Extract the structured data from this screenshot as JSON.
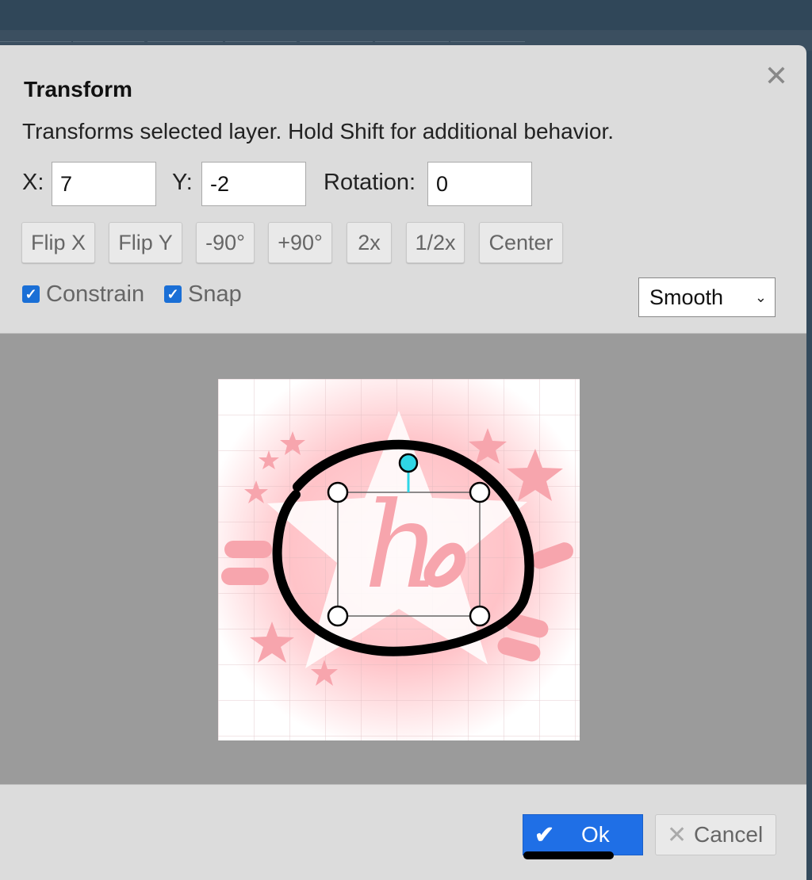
{
  "dialog": {
    "title": "Transform",
    "description": "Transforms selected layer. Hold Shift for additional behavior.",
    "close_icon": "close-icon"
  },
  "fields": {
    "x_label": "X:",
    "x_value": "7",
    "y_label": "Y:",
    "y_value": "-2",
    "rotation_label": "Rotation:",
    "rotation_value": "0"
  },
  "tools": {
    "flip_x": "Flip X",
    "flip_y": "Flip Y",
    "rotate_ccw": "-90°",
    "rotate_cw": "+90°",
    "scale_up": "2x",
    "scale_down": "1/2x",
    "center": "Center"
  },
  "options": {
    "constrain_label": "Constrain",
    "constrain_checked": true,
    "snap_label": "Snap",
    "snap_checked": true,
    "interpolation_selected": "Smooth"
  },
  "canvas": {
    "layer_text": "h"
  },
  "footer": {
    "ok_label": "Ok",
    "cancel_label": "Cancel"
  },
  "colors": {
    "accent": "#1f6fe6",
    "handle_rotate": "#2fd6e6",
    "artwork_pink": "#f7a5ad",
    "canvas_bg": "#9b9b9b",
    "dialog_bg": "#dcdcdc"
  }
}
